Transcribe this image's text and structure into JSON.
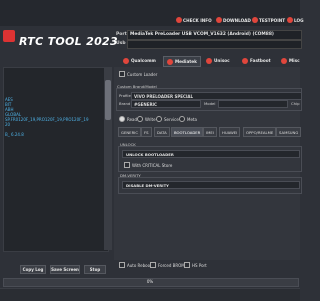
{
  "app": {
    "title": "RTC TOOL 2023"
  },
  "topbar": {
    "buttons": [
      {
        "label": "CHECK INFO",
        "icon": "info-icon",
        "color": "#e0463c"
      },
      {
        "label": "DOWNLOAD",
        "icon": "download-icon",
        "color": "#e0463c"
      },
      {
        "label": "TESTPOINT",
        "icon": "testpoint-icon",
        "color": "#e0463c"
      },
      {
        "label": "LOG",
        "icon": "log-icon",
        "color": "#e0463c"
      }
    ]
  },
  "connection": {
    "port_label": "Port",
    "port_value": "MediaTek PreLoader USB VCOM_V1632 (Android) (COM88)",
    "usb_label": "Usb",
    "usb_value": ""
  },
  "brand_tabs": [
    {
      "label": "Qualcomm",
      "color": "#e0463c",
      "active": false
    },
    {
      "label": "Mediatek",
      "color": "#e0463c",
      "active": true
    },
    {
      "label": "Unisoc",
      "color": "#e0463c",
      "active": false
    },
    {
      "label": "Fastboot",
      "color": "#e0463c",
      "active": false
    },
    {
      "label": "Misc",
      "color": "#e0463c",
      "active": false
    }
  ],
  "log_lines": [
    "AES",
    "BIT",
    "ABH",
    "GLOBAL",
    "SP.FR0120F_19,PRO120F_19,PRO120F_19",
    "20",
    "B_ 6.24.8"
  ],
  "custom_loader": {
    "label": "Custom Loader"
  },
  "custom_brand": {
    "title": "Custom Brand/Model",
    "profile_label": "Profile",
    "profile_value": "VIVO PRELOADER SPECIAL",
    "brand_label": "Brand",
    "brand_value": "#GENERIC",
    "model_label": "Model",
    "model_value": "",
    "chip_label": "Chip",
    "chip_value": ""
  },
  "modes": [
    "Read",
    "Write",
    "Service",
    "Meta"
  ],
  "sub_tabs": [
    {
      "label": "GENERIC",
      "active": false
    },
    {
      "label": "FS",
      "active": false
    },
    {
      "label": "DATA",
      "active": false
    },
    {
      "label": "BOOTLOADER",
      "active": true
    },
    {
      "label": "IMEI",
      "active": false
    },
    {
      "label": "HUAWEI",
      "active": false
    },
    {
      "label": "OPPO/REALME",
      "active": false
    },
    {
      "label": "SAMSUNG",
      "active": false
    }
  ],
  "unlock_group": {
    "title": "UNLOCK",
    "selected": "UNLOCK BOOTLOADER",
    "checkbox_label": "With CRITICAL Store"
  },
  "dm_group": {
    "title": "DM-VERITY",
    "selected": "DISABLE DM-VERITY"
  },
  "options": [
    "Auto Reboot",
    "Forced BROM",
    "HS Port"
  ],
  "buttons": {
    "copy_log": "Copy Log",
    "save_screen": "Save Screen",
    "stop": "Stop"
  },
  "progress": {
    "text": "0%",
    "value": 0
  }
}
